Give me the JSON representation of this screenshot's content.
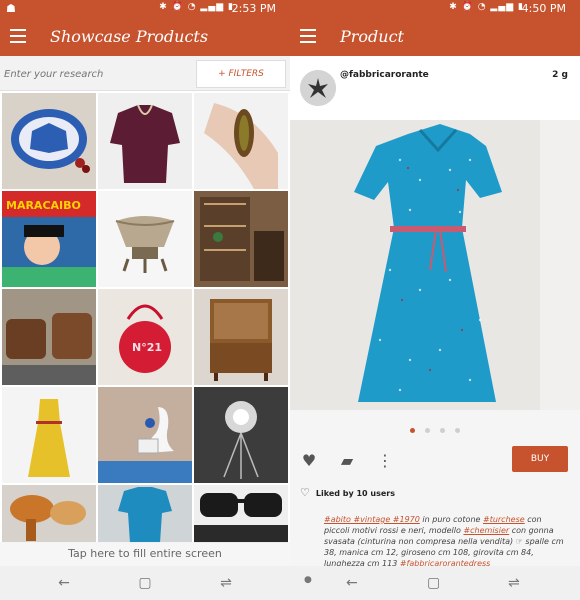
{
  "left": {
    "status": {
      "time": "2:53 PM",
      "icons": "✱ ⏰ ◔ ▂▄▆ ▮"
    },
    "appbar": {
      "title": "Showcase Products"
    },
    "search": {
      "placeholder": "Enter your research"
    },
    "filters_label": "+ FILTERS",
    "grid": [
      {
        "name": "butterfly-dish",
        "bg": "#e5e0d8"
      },
      {
        "name": "burgundy-blouse",
        "bg": "#eeeeee"
      },
      {
        "name": "brooch-in-hand",
        "bg": "#f0f0f0"
      },
      {
        "name": "maracaibo-record",
        "bg": "#2e6aa8"
      },
      {
        "name": "silver-bowl",
        "bg": "#f4f4f4"
      },
      {
        "name": "vintage-shelf-room",
        "bg": "#8a6a4e"
      },
      {
        "name": "brown-chairs",
        "bg": "#9a8a78"
      },
      {
        "name": "red-bag",
        "bg": "#e8e3dd"
      },
      {
        "name": "teak-cabinet",
        "bg": "#d9d3cb"
      },
      {
        "name": "yellow-dress",
        "bg": "#f2f2f2"
      },
      {
        "name": "swan-phone",
        "bg": "#bfa89a"
      },
      {
        "name": "ceiling-lamp",
        "bg": "#3e3e3e"
      },
      {
        "name": "hair-dryer",
        "bg": "#d5d0ca"
      },
      {
        "name": "blue-shirt",
        "bg": "#cfd3d6"
      },
      {
        "name": "sunglasses",
        "bg": "#eeeeee"
      }
    ],
    "fill_label": "Tap here to fill entire screen"
  },
  "right": {
    "status": {
      "time": "4:50 PM",
      "icons": "✱ ⏰ ◔ ▂▄▆ ▮"
    },
    "appbar": {
      "title": "Product"
    },
    "user": {
      "handle": "@fabbricarorante",
      "ago": "2 g"
    },
    "carousel": {
      "count": 4,
      "active": 0
    },
    "buy_label": "BUY",
    "liked": "Liked by 10 users",
    "description": {
      "text1": "#abito #vintage #1970",
      "text2": " in puro cotone ",
      "text3": "#turchese",
      "text4": " con piccoli motivi rossi e neri, modello ",
      "text5": "#chemisier",
      "text6": " con gonna svasata (cinturina non compresa nella vendita) ☞ spalle cm 38, manica cm 12, giroseno cm 108, girovita cm 84, lunghezza cm 113 ",
      "text7": "#fabbricarorantedress #fabbricarorantetuchese"
    }
  },
  "colors": {
    "accent": "#c7532e",
    "dress": "#1f9bc9"
  }
}
